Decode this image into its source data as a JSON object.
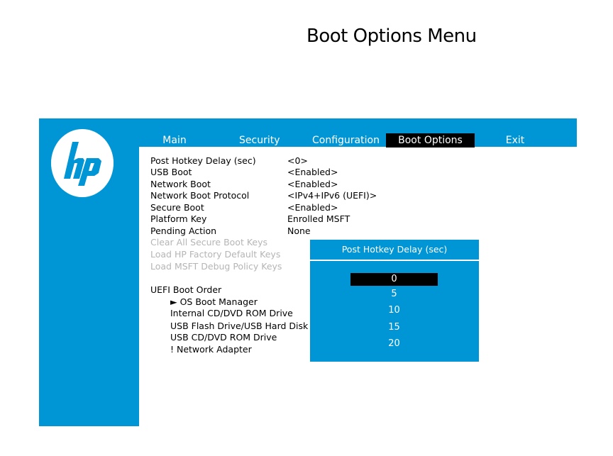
{
  "page_title": "Boot Options Menu",
  "tabs": [
    {
      "label": "Main"
    },
    {
      "label": "Security"
    },
    {
      "label": "Configuration"
    },
    {
      "label": "Boot Options",
      "active": true
    },
    {
      "label": "Exit"
    }
  ],
  "settings": [
    {
      "label": "Post Hotkey Delay (sec)",
      "value": "<0>"
    },
    {
      "label": "USB Boot",
      "value": "<Enabled>"
    },
    {
      "label": "Network Boot",
      "value": "<Enabled>"
    },
    {
      "label": "Network Boot Protocol",
      "value": "<IPv4+IPv6 (UEFI)>"
    },
    {
      "label": "Secure Boot",
      "value": "<Enabled>"
    },
    {
      "label": "Platform Key",
      "value": "Enrolled MSFT"
    },
    {
      "label": "Pending Action",
      "value": "None"
    },
    {
      "label": "Clear All Secure Boot Keys",
      "disabled": true
    },
    {
      "label": "Load HP Factory Default Keys",
      "disabled": true
    },
    {
      "label": "Load MSFT Debug Policy Keys",
      "disabled": true
    }
  ],
  "boot_order": {
    "heading": "UEFI Boot Order",
    "items": [
      "► OS Boot Manager",
      "Internal CD/DVD ROM Drive",
      "USB Flash Drive/USB Hard Disk",
      "USB CD/DVD ROM Drive",
      "! Network Adapter"
    ]
  },
  "popup": {
    "title": "Post Hotkey Delay (sec)",
    "options": [
      "0",
      "5",
      "10",
      "15",
      "20"
    ],
    "selected": "0"
  },
  "colors": {
    "bios_blue": "#0096d6",
    "selection": "#000000",
    "disabled_text": "#b5b5b5"
  },
  "logo": {
    "text": "hp",
    "icon": "hp-logo-icon"
  }
}
